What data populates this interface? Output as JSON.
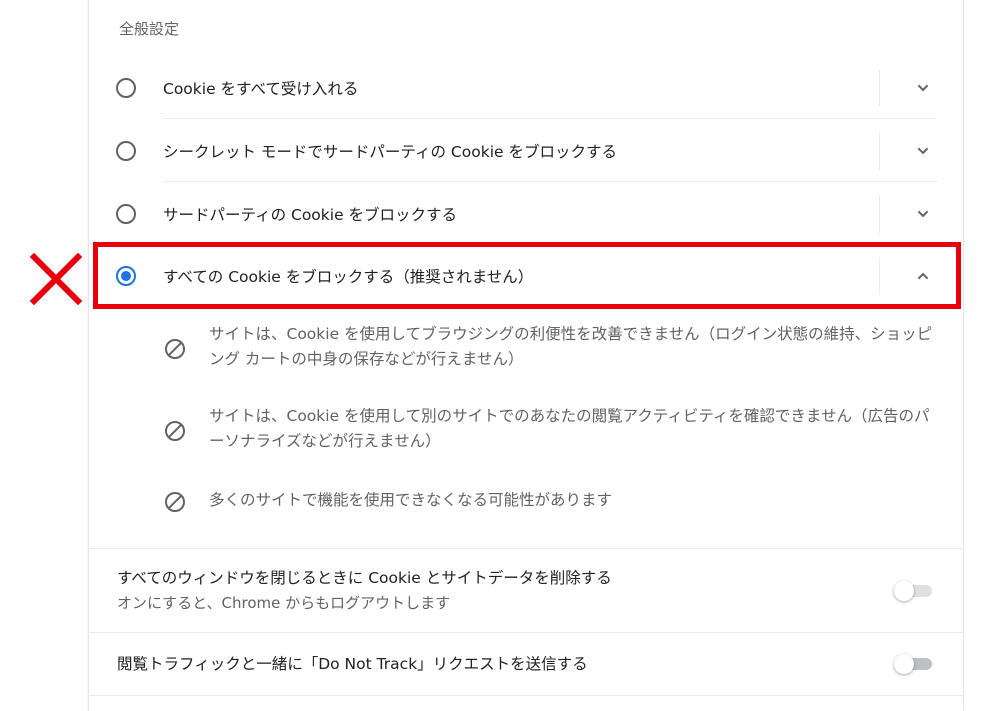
{
  "section": {
    "title": "全般設定"
  },
  "radio_options": [
    {
      "label": "Cookie をすべて受け入れる",
      "checked": false,
      "expanded": false
    },
    {
      "label": "シークレット モードでサードパーティの Cookie をブロックする",
      "checked": false,
      "expanded": false
    },
    {
      "label": "サードパーティの Cookie をブロックする",
      "checked": false,
      "expanded": false
    },
    {
      "label": "すべての Cookie をブロックする（推奨されません）",
      "checked": true,
      "expanded": true
    }
  ],
  "details": [
    {
      "icon": "block-icon",
      "text": "サイトは、Cookie を使用してブラウジングの利便性を改善できません（ログイン状態の維持、ショッピング カートの中身の保存などが行えません）"
    },
    {
      "icon": "block-icon",
      "text": "サイトは、Cookie を使用して別のサイトでのあなたの閲覧アクティビティを確認できません（広告のパーソナライズなどが行えません）"
    },
    {
      "icon": "block-icon",
      "text": "多くのサイトで機能を使用できなくなる可能性があります"
    }
  ],
  "settings": [
    {
      "title": "すべてのウィンドウを閉じるときに Cookie とサイトデータを削除する",
      "subtitle": "オンにすると、Chrome からもログアウトします",
      "toggle_on": false,
      "disabled": true
    },
    {
      "title": "閲覧トラフィックと一緒に「Do Not Track」リクエストを送信する",
      "toggle_on": false,
      "disabled": false
    }
  ],
  "annotation": {
    "highlight_color": "#e8000b",
    "mark": "x-mark"
  },
  "colors": {
    "accent": "#1a73e8",
    "text_primary": "#202124",
    "text_secondary": "#5f6368",
    "divider": "#e8eaed"
  }
}
